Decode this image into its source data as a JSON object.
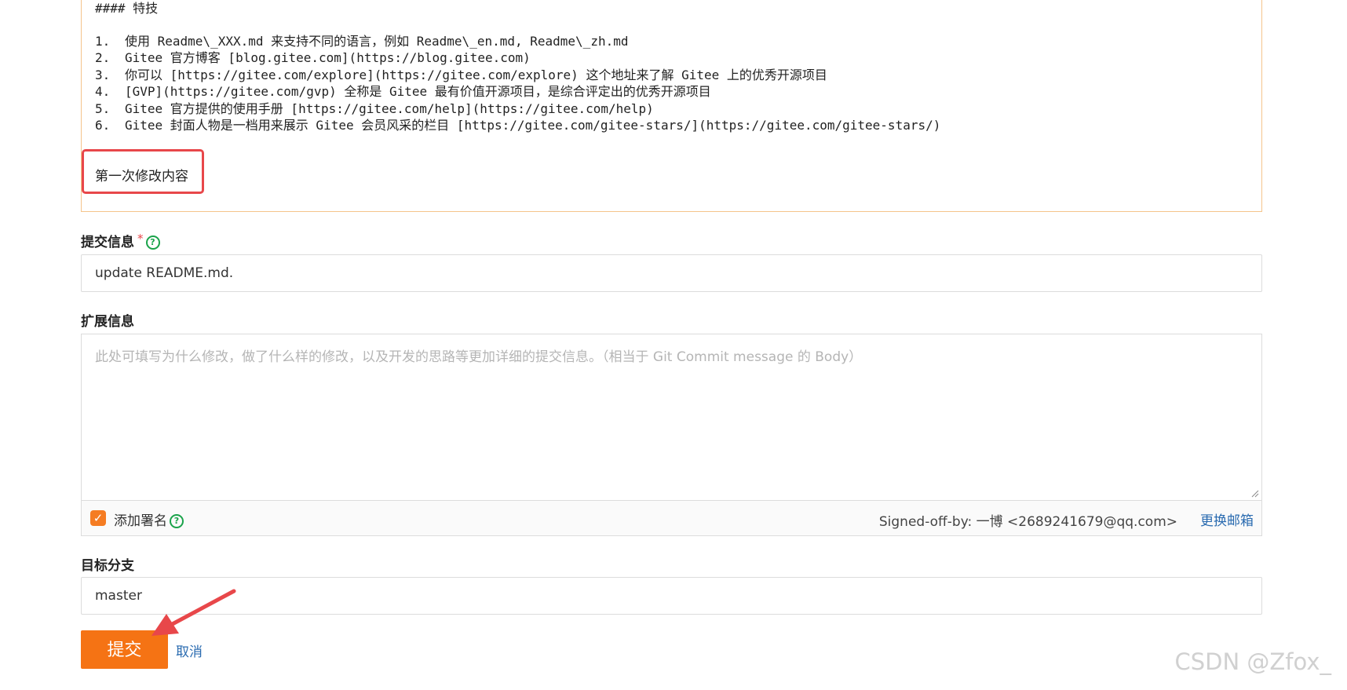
{
  "editor": {
    "heading": "#### 特技",
    "list": [
      {
        "num": "1.",
        "text": "使用 Readme\\_XXX.md 来支持不同的语言，例如 Readme\\_en.md, Readme\\_zh.md"
      },
      {
        "num": "2.",
        "text": "Gitee 官方博客 [blog.gitee.com](https://blog.gitee.com)"
      },
      {
        "num": "3.",
        "text": "你可以 [https://gitee.com/explore](https://gitee.com/explore) 这个地址来了解 Gitee 上的优秀开源项目"
      },
      {
        "num": "4.",
        "text": "[GVP](https://gitee.com/gvp) 全称是 Gitee 最有价值开源项目，是综合评定出的优秀开源项目"
      },
      {
        "num": "5.",
        "text": "Gitee 官方提供的使用手册 [https://gitee.com/help](https://gitee.com/help)"
      },
      {
        "num": "6.",
        "text": "Gitee 封面人物是一档用来展示 Gitee 会员风采的栏目 [https://gitee.com/gitee-stars/](https://gitee.com/gitee-stars/)"
      }
    ],
    "added_text": "第一次修改内容"
  },
  "commit": {
    "label": "提交信息",
    "required_mark": "*",
    "value": "update README.md."
  },
  "extended": {
    "label": "扩展信息",
    "placeholder": "此处可填写为什么修改，做了什么样的修改，以及开发的思路等更加详细的提交信息。（相当于 Git Commit message 的 Body）"
  },
  "signoff": {
    "checkbox_label": "添加署名",
    "checked": true,
    "value": "Signed-off-by: 一博 <2689241679@qq.com>",
    "change_email": "更换邮箱"
  },
  "branch": {
    "label": "目标分支",
    "value": "master"
  },
  "actions": {
    "submit": "提交",
    "cancel": "取消"
  },
  "watermark": "CSDN @Zfox_",
  "colors": {
    "accent": "#f57314",
    "highlight_border": "#e8474a",
    "link": "#2a6bb0",
    "help": "#1aa34a"
  }
}
